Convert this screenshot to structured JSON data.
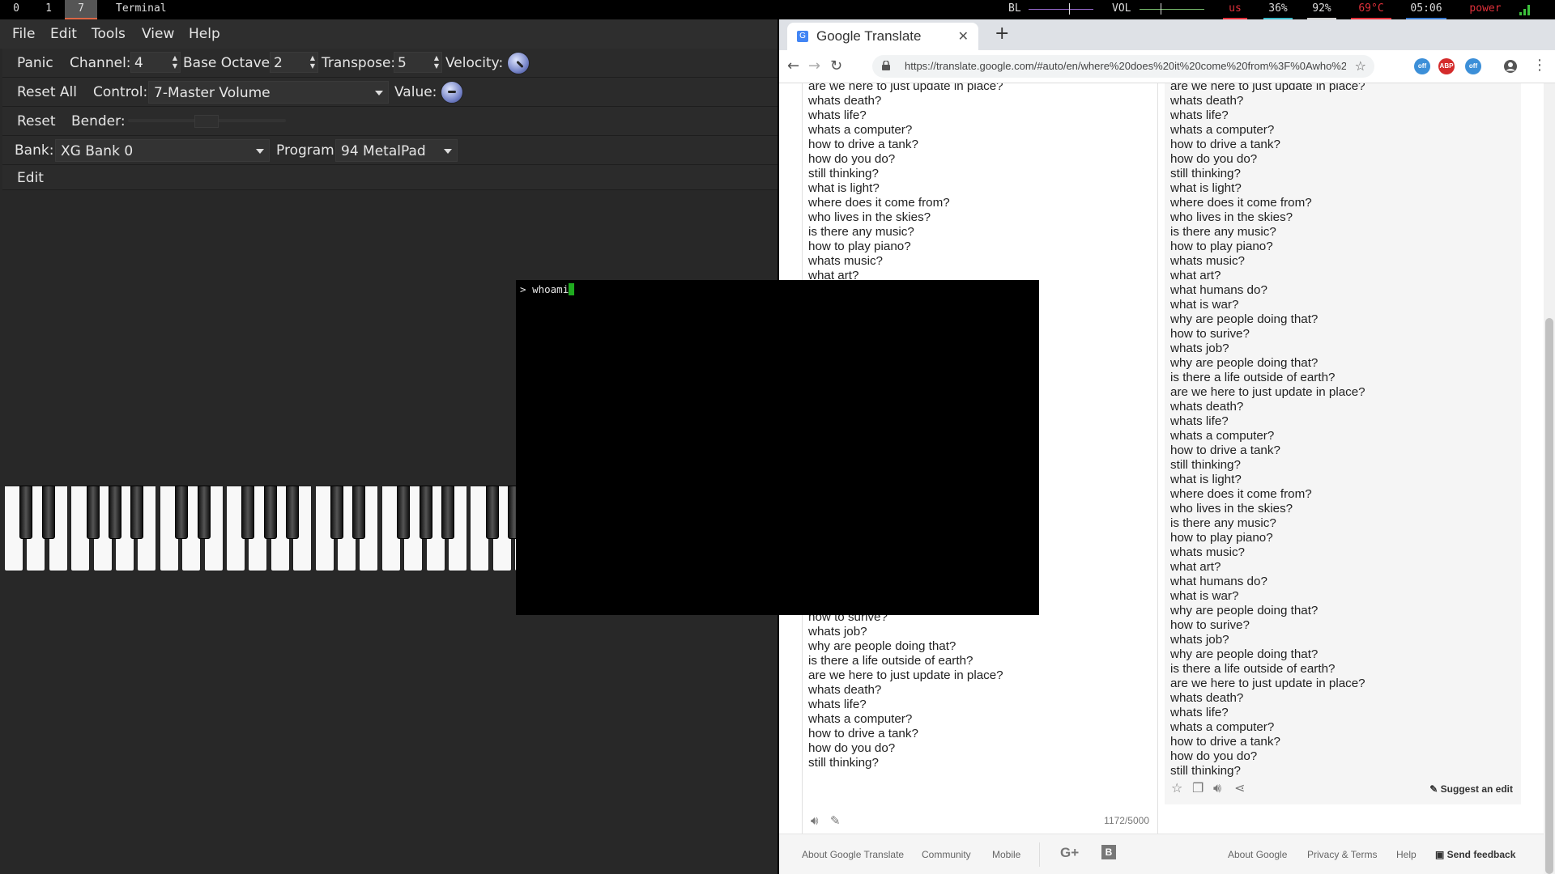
{
  "topbar": {
    "workspaces": [
      "0",
      "1",
      "7"
    ],
    "active_workspace": "7",
    "window_title": "Terminal",
    "backlight_label": "BL",
    "volume_label": "VOL",
    "keyboard_layout": "us",
    "cpu": "36%",
    "memory": "92%",
    "temperature": "69°C",
    "clock": "05:06",
    "power": "power",
    "colors": {
      "temperature": "#e0303a",
      "power": "#e0303a",
      "cpu_line": "#3ab8c8",
      "mem_line": "#d0d0d0",
      "accent": "#d64"
    }
  },
  "vmpk": {
    "menu": [
      "File",
      "Edit",
      "Tools",
      "View",
      "Help"
    ],
    "row1": {
      "panic": "Panic",
      "channel_label": "Channel:",
      "channel": "4",
      "octave_label": "Base Octave:",
      "octave": "2",
      "transpose_label": "Transpose:",
      "transpose": "5",
      "velocity_label": "Velocity:"
    },
    "row2": {
      "reset_all": "Reset All",
      "control_label": "Control:",
      "control": "7-Master Volume",
      "value_label": "Value:"
    },
    "row3": {
      "reset": "Reset",
      "bender_label": "Bender:"
    },
    "row4": {
      "bank_label": "Bank:",
      "bank": "XG Bank 0",
      "program_label": "Program:",
      "program": "94 MetalPad"
    },
    "row5": {
      "edit": "Edit"
    }
  },
  "browser": {
    "tab_title": "Google Translate",
    "tab_favicon": "G",
    "url": "https://translate.google.com/#auto/en/where%20does%20it%20come%20from%3F%0Awho%20lives...",
    "extensions": [
      "off",
      "ABP",
      "off"
    ],
    "source_lines_top": [
      "are we here to just update in place?",
      "whats death?",
      "whats life?",
      "whats a computer?",
      "how to drive a tank?",
      "how do you do?",
      "still thinking?",
      "what is light?",
      "where does it come from?",
      "who lives in the skies?",
      "is there any music?",
      "how to play piano?",
      "whats music?",
      "what art?"
    ],
    "source_lines_bottom": [
      "how to surive?",
      "whats job?",
      "why are people doing that?",
      "is there a life outside of earth?",
      "are we here to just update in place?",
      "whats death?",
      "whats life?",
      "whats a computer?",
      "how to drive a tank?",
      "how do you do?",
      "still thinking?"
    ],
    "target_lines": [
      "are we here to just update in place?",
      "whats death?",
      "whats life?",
      "whats a computer?",
      "how to drive a tank?",
      "how do you do?",
      "still thinking?",
      "what is light?",
      "where does it come from?",
      "who lives in the skies?",
      "is there any music?",
      "how to play piano?",
      "whats music?",
      "what art?",
      "what humans do?",
      "what is war?",
      "why are people doing that?",
      "how to surive?",
      "whats job?",
      "why are people doing that?",
      "is there a life outside of earth?",
      "are we here to just update in place?",
      "whats death?",
      "whats life?",
      "whats a computer?",
      "how to drive a tank?",
      "still thinking?",
      "what is light?",
      "where does it come from?",
      "who lives in the skies?",
      "is there any music?",
      "how to play piano?",
      "whats music?",
      "what art?",
      "what humans do?",
      "what is war?",
      "why are people doing that?",
      "how to surive?",
      "whats job?",
      "why are people doing that?",
      "is there a life outside of earth?",
      "are we here to just update in place?",
      "whats death?",
      "whats life?",
      "whats a computer?",
      "how to drive a tank?",
      "how do you do?",
      "still thinking?"
    ],
    "char_count": "1172/5000",
    "suggest_edit": "Suggest an edit",
    "footer": {
      "about_translate": "About Google Translate",
      "community": "Community",
      "mobile": "Mobile",
      "about_google": "About Google",
      "privacy": "Privacy & Terms",
      "help": "Help",
      "send_feedback": "Send feedback"
    }
  },
  "terminal": {
    "prompt": ">",
    "command": "whoami"
  }
}
